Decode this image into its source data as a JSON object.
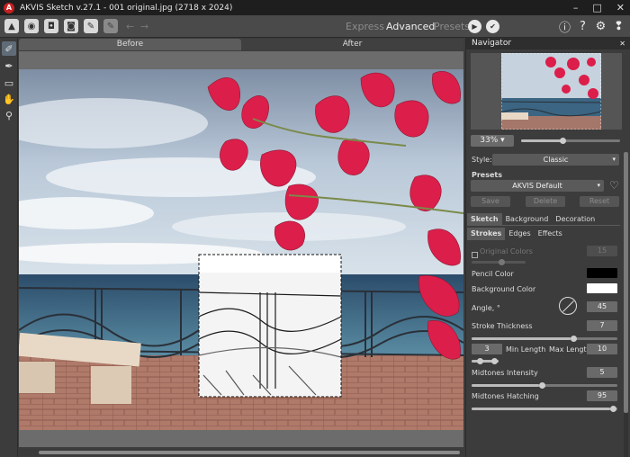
{
  "window": {
    "title": "AKVIS Sketch v.27.1 - 001 original.jpg (2718 x 2024)",
    "logo": "A",
    "minimize": "–",
    "maximize": "□",
    "close": "✕"
  },
  "toolbar": {
    "modes": [
      "Express",
      "Advanced",
      "Presets"
    ],
    "active_mode": "Advanced"
  },
  "canvas": {
    "tab_before": "Before",
    "tab_after": "After"
  },
  "navigator": {
    "title": "Navigator",
    "close": "✕",
    "zoom": "33%",
    "zoom_caret": "▾",
    "zoom_level": 0.42
  },
  "style": {
    "label": "Style:",
    "value": "Classic",
    "caret": "▾"
  },
  "presets": {
    "label": "Presets",
    "value": "AKVIS Default",
    "caret": "▾",
    "buttons": [
      "Save",
      "Delete",
      "Reset"
    ]
  },
  "tabs": [
    "Sketch",
    "Background",
    "Decoration"
  ],
  "subtabs": [
    "Strokes",
    "Edges",
    "Effects"
  ],
  "settings": {
    "original_colors": "Original Colors",
    "original_colors_value": "15",
    "pencil_color": "Pencil Color",
    "background_color": "Background Color",
    "angle_label": "Angle, °",
    "angle": "45",
    "stroke_thickness_label": "Stroke Thickness",
    "stroke_thickness": "7",
    "min_length_value": "3",
    "min_length_label": "Min Length",
    "max_length_label": "Max Length",
    "max_length_value": "10",
    "midtones_intensity_label": "Midtones Intensity",
    "midtones_intensity": "5",
    "midtones_hatching_label": "Midtones Hatching",
    "midtones_hatching": "95"
  },
  "colors": {
    "pencil": "#000000",
    "background": "#ffffff",
    "accent": "#c8201e"
  }
}
